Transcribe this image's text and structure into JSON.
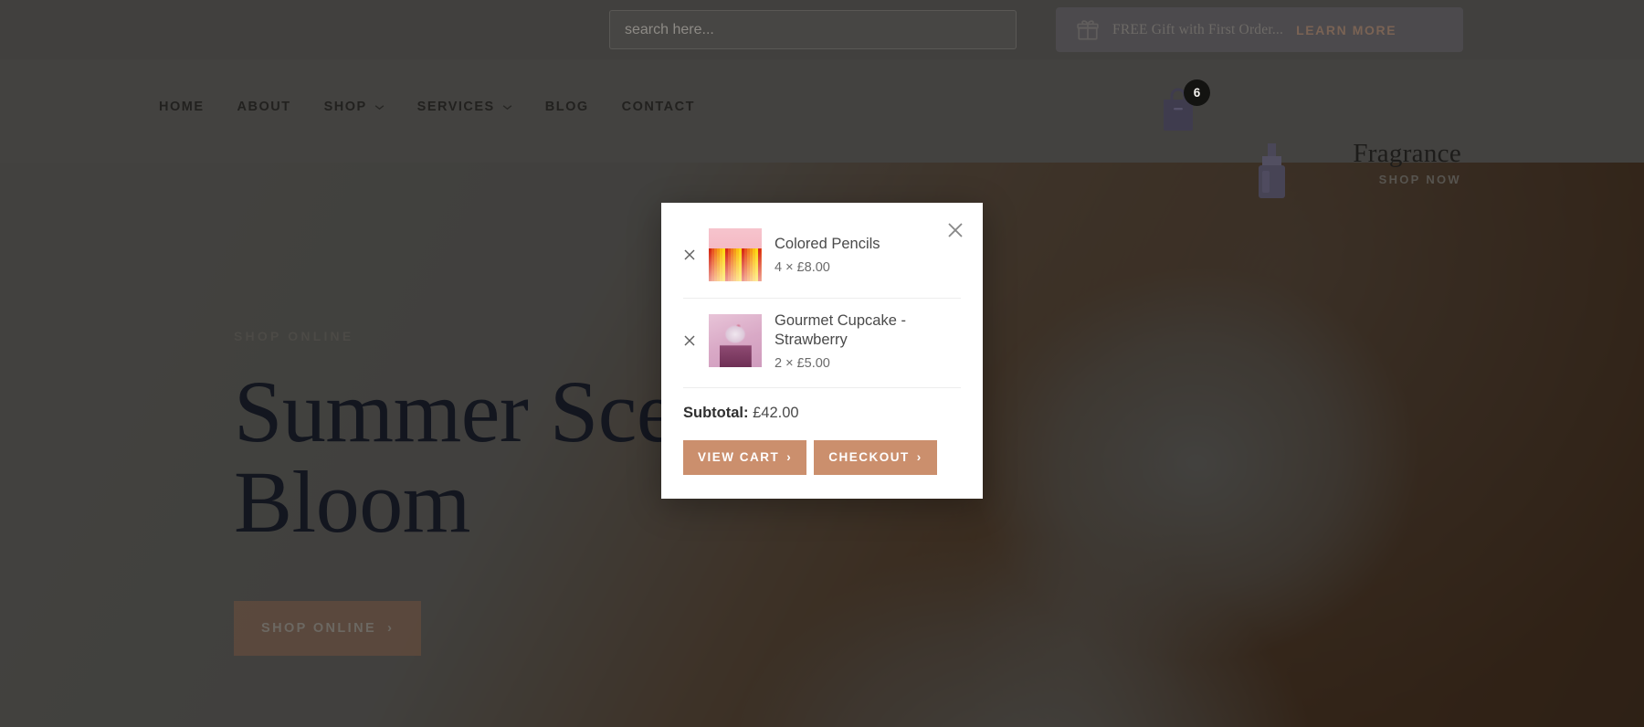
{
  "topbar": {
    "search": {
      "placeholder": "search here...",
      "value": "",
      "icon": "search-icon"
    },
    "promo": {
      "icon": "gift-icon",
      "text": "FREE Gift with First Order...",
      "link_label": "LEARN MORE"
    }
  },
  "nav": {
    "items": [
      {
        "label": "HOME",
        "has_dropdown": false
      },
      {
        "label": "ABOUT",
        "has_dropdown": false
      },
      {
        "label": "SHOP",
        "has_dropdown": true
      },
      {
        "label": "SERVICES",
        "has_dropdown": true
      },
      {
        "label": "BLOG",
        "has_dropdown": false
      },
      {
        "label": "CONTACT",
        "has_dropdown": false
      }
    ],
    "cart": {
      "icon": "shopping-bag-icon",
      "badge_count": "6"
    },
    "brand": {
      "name": "Fragrance",
      "sub": "SHOP NOW",
      "bottle_icon": "perfume-bottle-icon"
    }
  },
  "hero": {
    "eyebrow": "SHOP ONLINE",
    "title": "Summer Scents Bloom",
    "cta_label": "SHOP ONLINE",
    "cta_chevron": "›"
  },
  "mini_cart": {
    "close_icon": "close-icon",
    "items": [
      {
        "name": "Colored Pencils",
        "qty_price": "4 × £8.00",
        "remove_icon": "remove-item-icon",
        "thumb": "colored-pencils-thumbnail"
      },
      {
        "name": "Gourmet Cupcake - Strawberry",
        "qty_price": "2 × £5.00",
        "remove_icon": "remove-item-icon",
        "thumb": "gourmet-cupcake-thumbnail"
      }
    ],
    "subtotal_label": "Subtotal:",
    "subtotal_value": "£42.00",
    "view_cart_label": "VIEW CART",
    "checkout_label": "CHECKOUT",
    "button_chevron": "›"
  },
  "colors": {
    "cart_button": "#cb8f6d",
    "badge": "#131311",
    "scrim": "rgba(22,22,20,0.80)",
    "hero_title": "#13161f",
    "promo_link": "#7a6354"
  }
}
